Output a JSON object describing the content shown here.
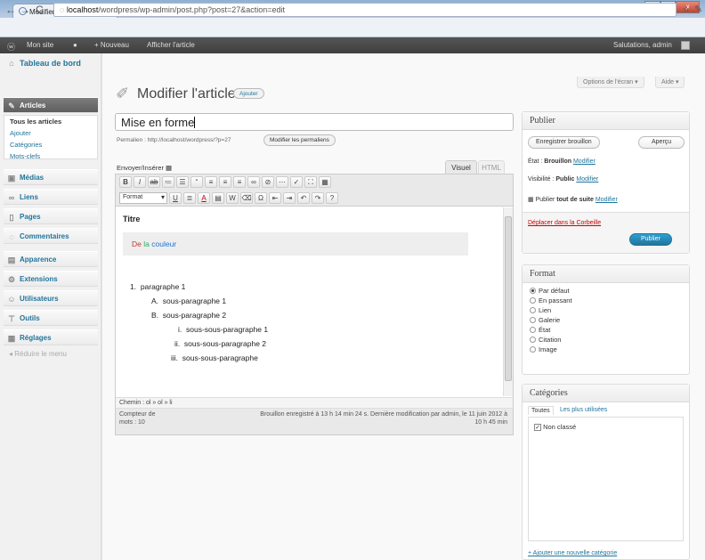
{
  "browser": {
    "tab_title": "Modifier l'article - Mon site",
    "tab_close": "×",
    "url_host": "localhost",
    "url_path": "/wordpress/wp-admin/post.php?post=27&action=edit",
    "win_min": "–",
    "win_max": "□",
    "win_close": "x"
  },
  "adminbar": {
    "site": "Mon site",
    "new": "+ Nouveau",
    "view": "Afficher l'article",
    "greeting": "Salutations, admin"
  },
  "sidebar": {
    "dashboard": "Tableau de bord",
    "articles": "Articles",
    "sub": [
      "Tous les articles",
      "Ajouter",
      "Catégories",
      "Mots-clefs"
    ],
    "items": [
      "Médias",
      "Liens",
      "Pages",
      "Commentaires",
      "Apparence",
      "Extensions",
      "Utilisateurs",
      "Outils",
      "Réglages"
    ],
    "reduce": "Réduire le menu"
  },
  "header": {
    "title": "Modifier l'article",
    "add_new": "Ajouter",
    "screen_options": "Options de l'écran ▾",
    "help": "Aide ▾"
  },
  "post": {
    "title": "Mise en forme",
    "permalink": "Permalien : http://localhost/wordpress/?p=27",
    "permalink_btn": "Modifier les permaliens",
    "upload": "Envoyer/Insérer",
    "tab_visual": "Visuel",
    "tab_html": "HTML",
    "format_select": "Format"
  },
  "content": {
    "heading": "Titre",
    "color_word1": "De",
    "color_word2": "la",
    "color_word3": "couleur",
    "list": [
      {
        "marker": "1.",
        "text": "paragraphe 1"
      },
      {
        "marker": "A.",
        "text": "sous-paragraphe 1"
      },
      {
        "marker": "B.",
        "text": "sous-paragraphe 2"
      },
      {
        "marker": "i.",
        "text": "sous-sous-paragraphe 1"
      },
      {
        "marker": "ii.",
        "text": "sous-sous-paragraphe 2"
      },
      {
        "marker": "iii.",
        "text": "sous-sous-paragraphe"
      }
    ]
  },
  "status": {
    "path": "Chemin : ol » ol » li",
    "wordcount_label": "Compteur de",
    "wordcount_value": "mots : 10",
    "draft_line1": "Brouillon enregistré à 13 h 14 min 24 s. Dernière modification par admin, le 11 juin 2012 à",
    "draft_line2": "10 h 45 min"
  },
  "publish": {
    "title": "Publier",
    "save_draft": "Enregistrer brouillon",
    "preview": "Aperçu",
    "state_label": "État : ",
    "state_value": "Brouillon",
    "visibility_label": "Visibilité : ",
    "visibility_value": "Public",
    "schedule_label": "Publier ",
    "schedule_value": "tout de suite",
    "edit": "Modifier",
    "trash": "Déplacer dans la Corbeille",
    "publish_btn": "Publier"
  },
  "format": {
    "title": "Format",
    "options": [
      "Par défaut",
      "En passant",
      "Lien",
      "Galerie",
      "État",
      "Citation",
      "Image"
    ],
    "selected": 0
  },
  "categories": {
    "title": "Catégories",
    "tab_all": "Toutes",
    "tab_popular": "Les plus utilisées",
    "item": "Non classé",
    "add": "+ Ajouter une nouvelle catégorie"
  }
}
